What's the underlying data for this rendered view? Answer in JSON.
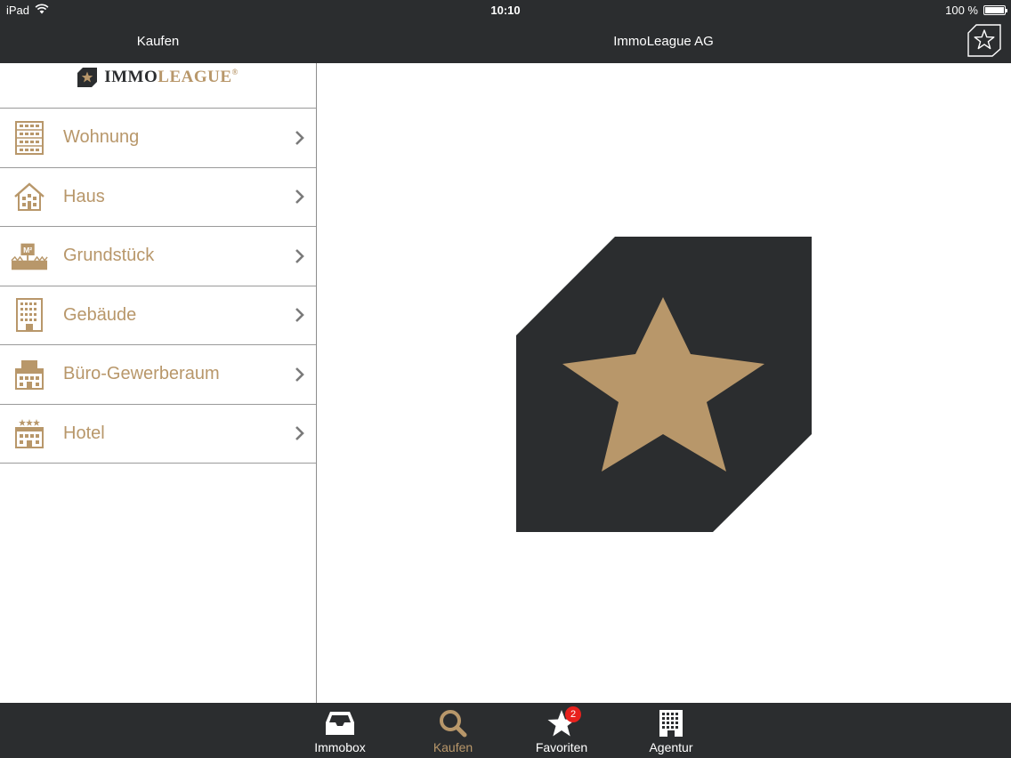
{
  "status_bar": {
    "carrier": "iPad",
    "time": "10:10",
    "battery": "100 %",
    "battery_level": 1.0
  },
  "nav_bar": {
    "left_title": "Kaufen",
    "center_title": "ImmoLeague AG",
    "favorites_button_icon": "star-outline-icon"
  },
  "logo": {
    "immo": "IMMO",
    "league": "LEAGUE",
    "reg": "®"
  },
  "menu": {
    "items": [
      {
        "label": "Wohnung",
        "icon": "apartment-icon"
      },
      {
        "label": "Haus",
        "icon": "house-icon"
      },
      {
        "label": "Grundstück",
        "icon": "land-plot-icon"
      },
      {
        "label": "Gebäude",
        "icon": "building-icon"
      },
      {
        "label": "Büro-Gewerberaum",
        "icon": "office-icon"
      },
      {
        "label": "Hotel",
        "icon": "hotel-icon"
      }
    ],
    "plot_icon_text": "M²"
  },
  "tabbar": {
    "tabs": [
      {
        "label": "Immobox",
        "icon": "inbox-icon",
        "active": false
      },
      {
        "label": "Kaufen",
        "icon": "search-icon",
        "active": true
      },
      {
        "label": "Favoriten",
        "icon": "star-icon",
        "active": false,
        "badge": "2"
      },
      {
        "label": "Agentur",
        "icon": "agency-building-icon",
        "active": false
      }
    ]
  },
  "colors": {
    "dark": "#2b2d2f",
    "gold": "#b8976a",
    "badge": "#e8211d"
  }
}
